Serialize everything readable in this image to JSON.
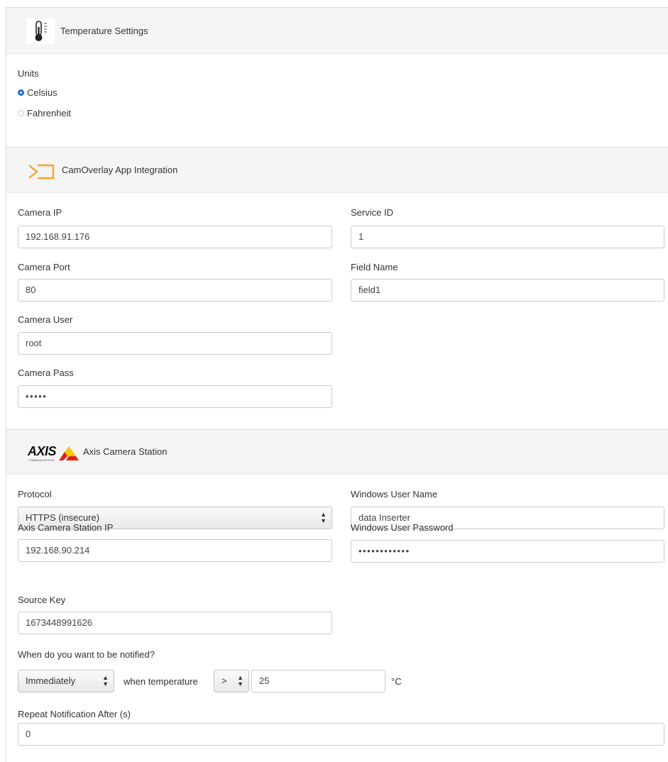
{
  "temperature": {
    "title": "Temperature Settings",
    "units_label": "Units",
    "options": [
      "Celsius",
      "Fahrenheit"
    ],
    "selected": "Celsius"
  },
  "camoverlay": {
    "title": "CamOverlay App Integration",
    "camera_ip_label": "Camera IP",
    "camera_ip": "192.168.91.176",
    "camera_port_label": "Camera Port",
    "camera_port": "80",
    "camera_user_label": "Camera User",
    "camera_user": "root",
    "camera_pass_label": "Camera Pass",
    "camera_pass": "•••••",
    "service_id_label": "Service ID",
    "service_id": "1",
    "field_name_label": "Field Name",
    "field_name": "field1"
  },
  "axis": {
    "logo_text": "AXIS",
    "logo_sub": "COMMUNICATIONS",
    "title": "Axis Camera Station",
    "protocol_label": "Protocol",
    "protocol": "HTTPS (insecure)",
    "acs_ip_label": "Axis Camera Station IP",
    "acs_ip": "192.168.90.214",
    "source_key_label": "Source Key",
    "source_key": "1673448991626",
    "win_user_label": "Windows User Name",
    "win_user": "data Inserter",
    "win_pass_label": "Windows User Password",
    "win_pass": "••••••••••••",
    "notify_label": "When do you want to be notified?",
    "notify_when": "Immediately",
    "when_temp_text": "when temperature",
    "operator": ">",
    "threshold": "25",
    "unit_suffix": "°C",
    "repeat_label": "Repeat Notification After (s)",
    "repeat_value": "0"
  },
  "colors": {
    "accent_blue": "#1e6ad8",
    "camoverlay_orange": "#f5a623",
    "axis_yellow": "#f7c600",
    "axis_red": "#e2231a"
  }
}
